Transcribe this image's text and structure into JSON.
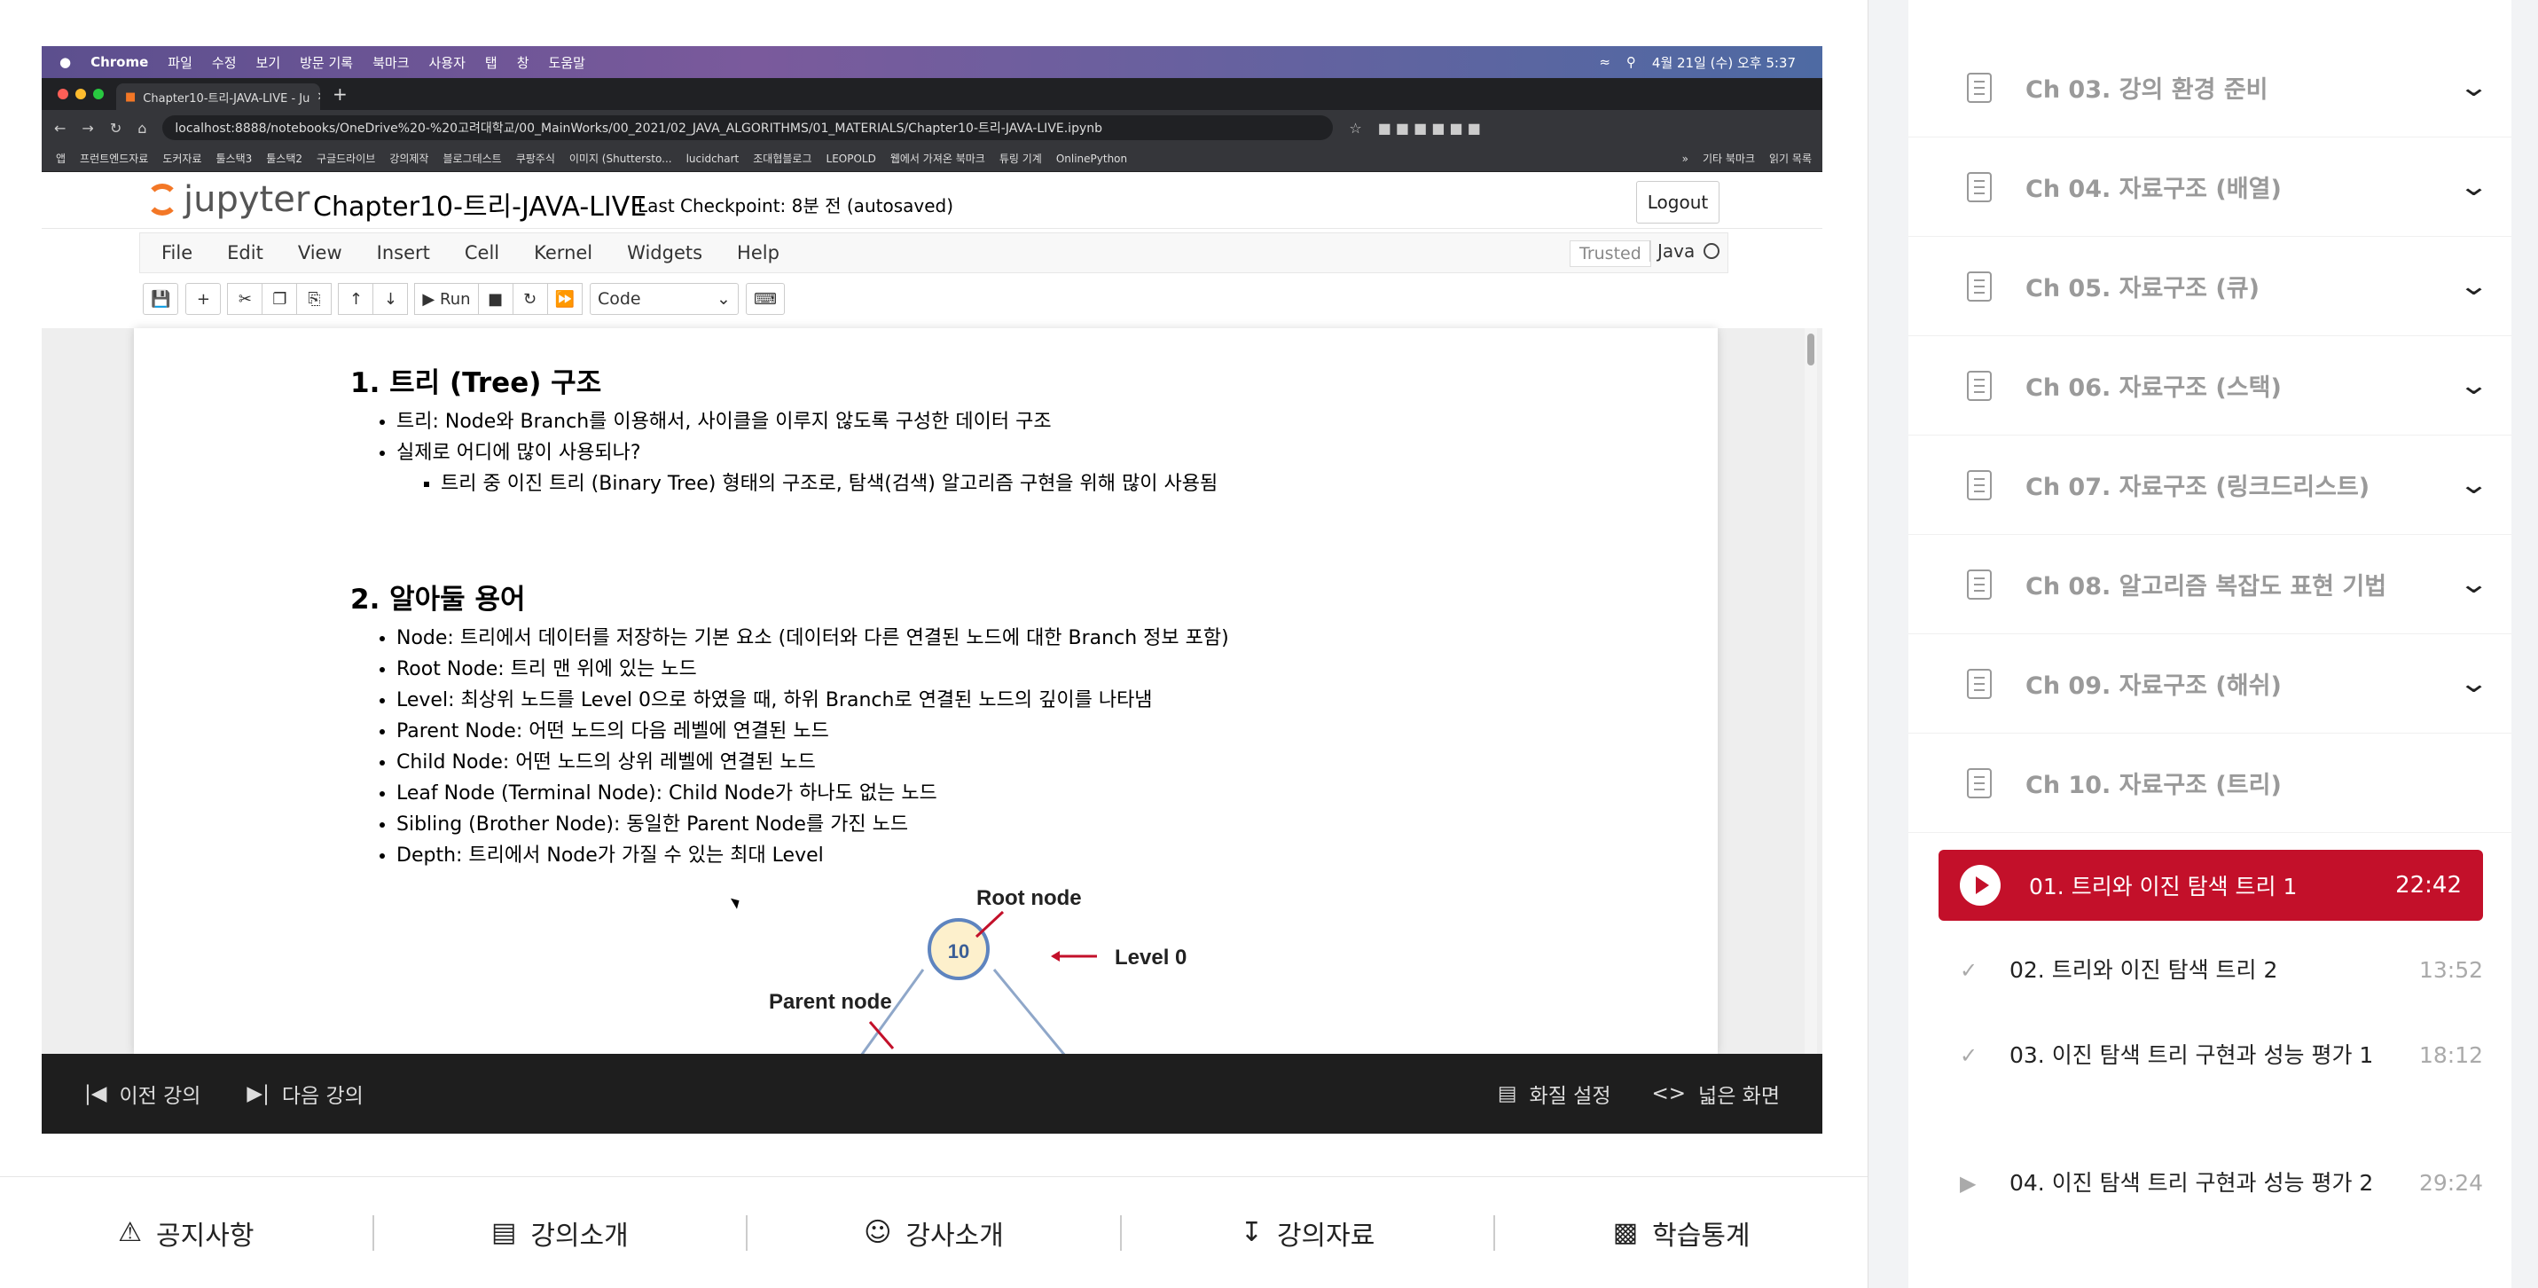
{
  "browser": {
    "menubar": [
      "Chrome",
      "파일",
      "수정",
      "보기",
      "방문 기록",
      "북마크",
      "사용자",
      "탭",
      "창",
      "도움말"
    ],
    "menubar_right": "4월 21일 (수) 오후 5:37",
    "tab_title": "Chapter10-트리-JAVA-LIVE - Ju",
    "url": "localhost:8888/notebooks/OneDrive%20-%20고려대학교/00_MainWorks/00_2021/02_JAVA_ALGORITHMS/01_MATERIALS/Chapter10-트리-JAVA-LIVE.ipynb",
    "bookmarks": [
      "앱",
      "프런트엔드자료",
      "도커자료",
      "툴스택3",
      "툴스택2",
      "구글드라이브",
      "강의제작",
      "블로그테스트",
      "쿠팡주식",
      "이미지 (Shuttersto...",
      "lucidchart",
      "조대협블로그",
      "LEOPOLD",
      "웹에서 가져온 북마크",
      "튜링 기계",
      "OnlinePython"
    ],
    "bookmarks_more": "»",
    "bookmarks_right": [
      "기타 북마크",
      "읽기 목록"
    ]
  },
  "jupyter": {
    "logo": "jupyter",
    "notebook_title": "Chapter10-트리-JAVA-LIVE",
    "checkpoint": "Last Checkpoint: 8분 전  (autosaved)",
    "logout": "Logout",
    "menu": [
      "File",
      "Edit",
      "View",
      "Insert",
      "Cell",
      "Kernel",
      "Widgets",
      "Help"
    ],
    "trusted": "Trusted",
    "kernel": "Java",
    "run": "Run",
    "cell_type": "Code"
  },
  "content": {
    "h1": "1. 트리 (Tree) 구조",
    "s1": [
      "트리: Node와 Branch를 이용해서, 사이클을 이루지 않도록 구성한 데이터 구조",
      "실제로 어디에 많이 사용되나?"
    ],
    "s1_sub": "트리 중 이진 트리 (Binary Tree) 형태의 구조로, 탐색(검색) 알고리즘 구현을 위해 많이 사용됨",
    "h2": "2. 알아둘 용어",
    "s2": [
      "Node: 트리에서 데이터를 저장하는 기본 요소 (데이터와 다른 연결된 노드에 대한 Branch 정보 포함)",
      "Root Node: 트리 맨 위에 있는 노드",
      "Level: 최상위 노드를 Level 0으로 하였을 때, 하위 Branch로 연결된 노드의 깊이를 나타냄",
      "Parent Node: 어떤 노드의 다음 레벨에 연결된 노드",
      "Child Node: 어떤 노드의 상위 레벨에 연결된 노드",
      "Leaf Node (Terminal Node): Child Node가 하나도 없는 노드",
      "Sibling (Brother Node): 동일한 Parent Node를 가진 노드",
      "Depth: 트리에서 Node가 가질 수 있는 최대 Level"
    ],
    "diagram": {
      "root_label": "Root node",
      "parent_label": "Parent node",
      "level_label": "Level 0",
      "root_value": "10"
    }
  },
  "player": {
    "prev": "이전 강의",
    "next": "다음 강의",
    "quality": "화질 설정",
    "wide": "넓은 화면"
  },
  "bottom_tabs": [
    "공지사항",
    "강의소개",
    "강사소개",
    "강의자료",
    "학습통계"
  ],
  "sidebar": {
    "chapters": [
      "Ch 03. 강의 환경 준비",
      "Ch 04. 자료구조 (배열)",
      "Ch 05. 자료구조 (큐)",
      "Ch 06. 자료구조 (스택)",
      "Ch 07. 자료구조 (링크드리스트)",
      "Ch 08. 알고리즘 복잡도 표현 기법",
      "Ch 09. 자료구조 (해쉬)",
      "Ch 10. 자료구조 (트리)"
    ],
    "active_lecture": {
      "title": "01. 트리와 이진 탐색 트리 1",
      "duration": "22:42"
    },
    "lectures": [
      {
        "title": "02. 트리와 이진 탐색 트리 2",
        "duration": "13:52",
        "marker": "✓"
      },
      {
        "title": "03. 이진 탐색 트리 구현과 성능 평가 1",
        "duration": "18:12",
        "marker": "✓"
      },
      {
        "title": "04. 이진 탐색 트리 구현과 성능 평가 2",
        "duration": "29:24",
        "marker": "▶"
      }
    ]
  },
  "colors": {
    "accent": "#c3102a",
    "jupyter_orange": "#f37726"
  }
}
